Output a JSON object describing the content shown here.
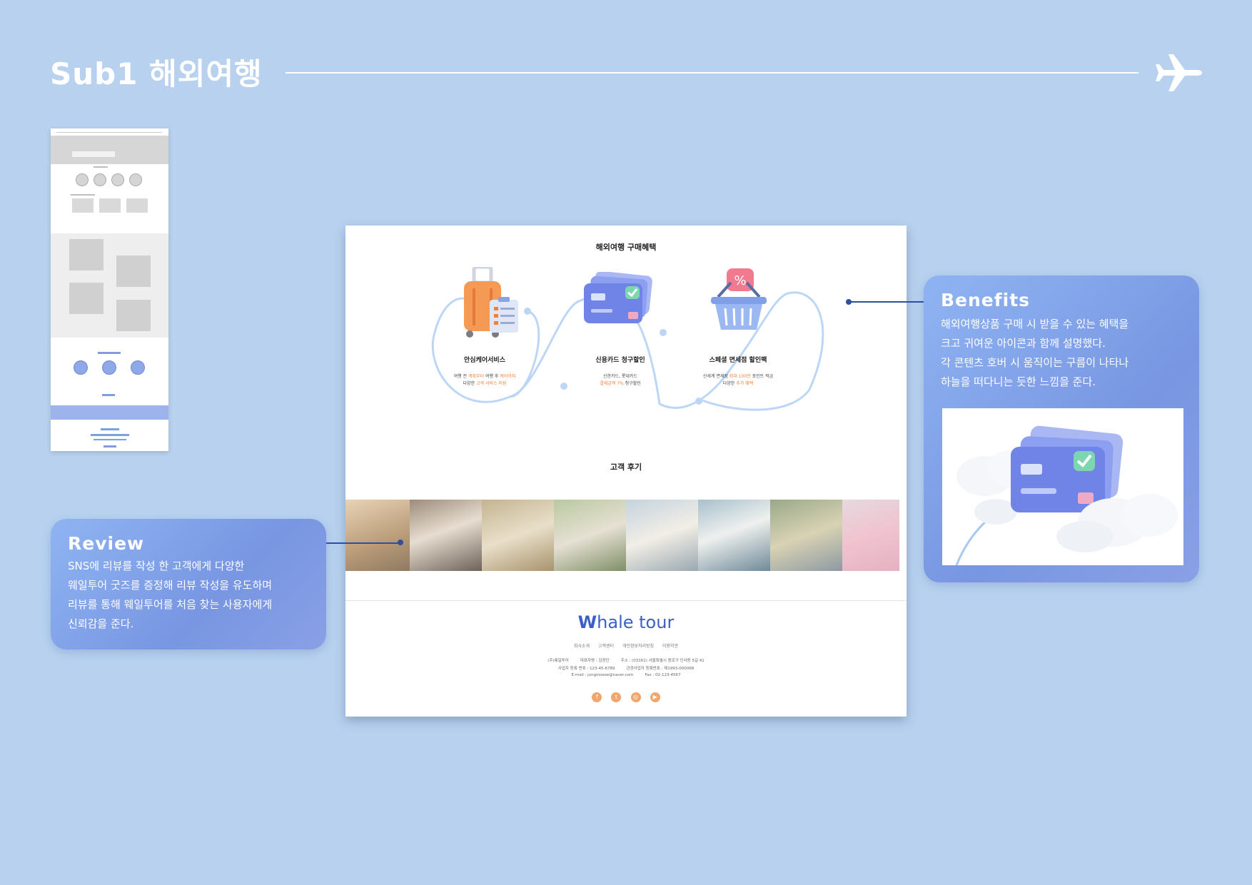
{
  "header": {
    "title": "Sub1 해외여행"
  },
  "icons": [
    "airplane-icon"
  ],
  "colors": {
    "background": "#b7d1ef",
    "accent": "#7896e2",
    "highlight": "#f08038",
    "brand": "#3a5fc8"
  },
  "mock": {
    "benefits": {
      "title": "해외여행 구매혜택",
      "items": [
        {
          "name": "안심케어서비스",
          "line1_a": "여행 전 ",
          "line1_b": "계획부터",
          "line1_c": " 여행 후 ",
          "line1_d": "케어까지",
          "line2_a": "다양한 ",
          "line2_b": "고객 서비스 지원",
          "line2_c": ""
        },
        {
          "name": "신용카드 청구할인",
          "line1_a": "신한카드, 롯데카드",
          "line1_b": "",
          "line1_c": "",
          "line1_d": "",
          "line2_a": "",
          "line2_b": "결제금액 7%",
          "line2_c": " 청구할인"
        },
        {
          "name": "스페셜 면세점 할인팩",
          "line1_a": "신세계 면세점 ",
          "line1_b": "최대 100만",
          "line1_c": " 포인트 적금",
          "line1_d": "",
          "line2_a": "다양한 ",
          "line2_b": "추가 혜택",
          "line2_c": ""
        }
      ]
    },
    "review": {
      "title": "고객 후기"
    },
    "footer": {
      "logo_w": "W",
      "logo_rest": "hale tour",
      "links": [
        "회사소개",
        "고객센터",
        "개인정보처리방침",
        "이용약관"
      ],
      "info_row1": [
        "(주)웨일투어",
        "대표자명 : 김정인",
        "주소 : (03161) 서울특별시 종로구 인사동 5길 41"
      ],
      "info_row2": [
        "사업자 등록 번호 : 123-45-6789",
        "관광사업자 등록번호 : 제1993-000068"
      ],
      "info_row3": [
        "E-mail : junginoese@naver.com",
        "Fax : 02-123-4567"
      ],
      "social": [
        "facebook-icon",
        "twitter-icon",
        "instagram-icon",
        "youtube-icon"
      ]
    }
  },
  "benefits_card": {
    "title": "Benefits",
    "lines": [
      "해외여행상품 구매 시 받을 수 있는 혜택을",
      "크고 귀여운 아이콘과 함께 설명했다.",
      "각 콘텐츠 호버 시 움직이는 구름이 나타나",
      "하늘을 떠다니는 듯한 느낌을 준다."
    ]
  },
  "review_card": {
    "title": "Review",
    "lines": [
      "SNS에 리뷰를 작성 한 고객에게 다양한",
      "웨일투어 굿즈를 증정해 리뷰 작성을 유도하며",
      "리뷰를 통해 웨일투어를 처음 찾는 사용자에게",
      "신뢰감을 준다."
    ]
  }
}
